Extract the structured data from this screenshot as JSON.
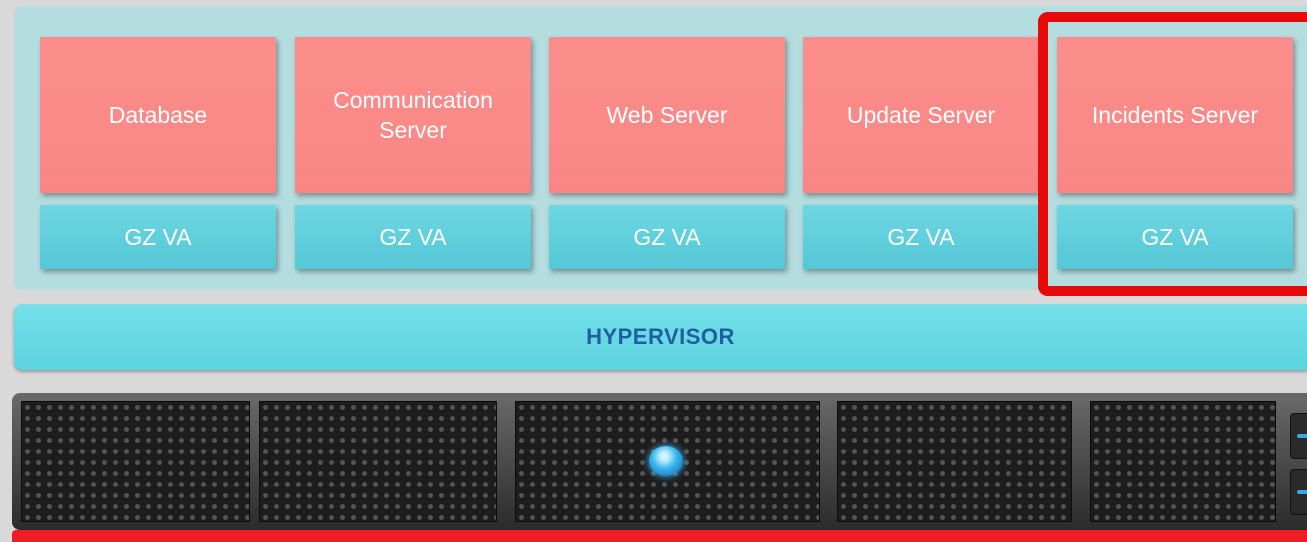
{
  "applications": [
    {
      "label": "Database"
    },
    {
      "label": "Communication Server"
    },
    {
      "label": "Web Server"
    },
    {
      "label": "Update Server"
    },
    {
      "label": "Incidents Server"
    }
  ],
  "va_labels": [
    "GZ VA",
    "GZ VA",
    "GZ VA",
    "GZ VA",
    "GZ VA"
  ],
  "hypervisor": {
    "label": "HYPERVISOR"
  },
  "colors": {
    "app_box": "#f98a88",
    "va_box": "#5ccbd9",
    "hypervisor": "#66d9e4",
    "hypervisor_text": "#1f5f9e",
    "highlight": "#e8090b",
    "server_led": "#3ab6f0"
  },
  "highlighted_stack": 4
}
